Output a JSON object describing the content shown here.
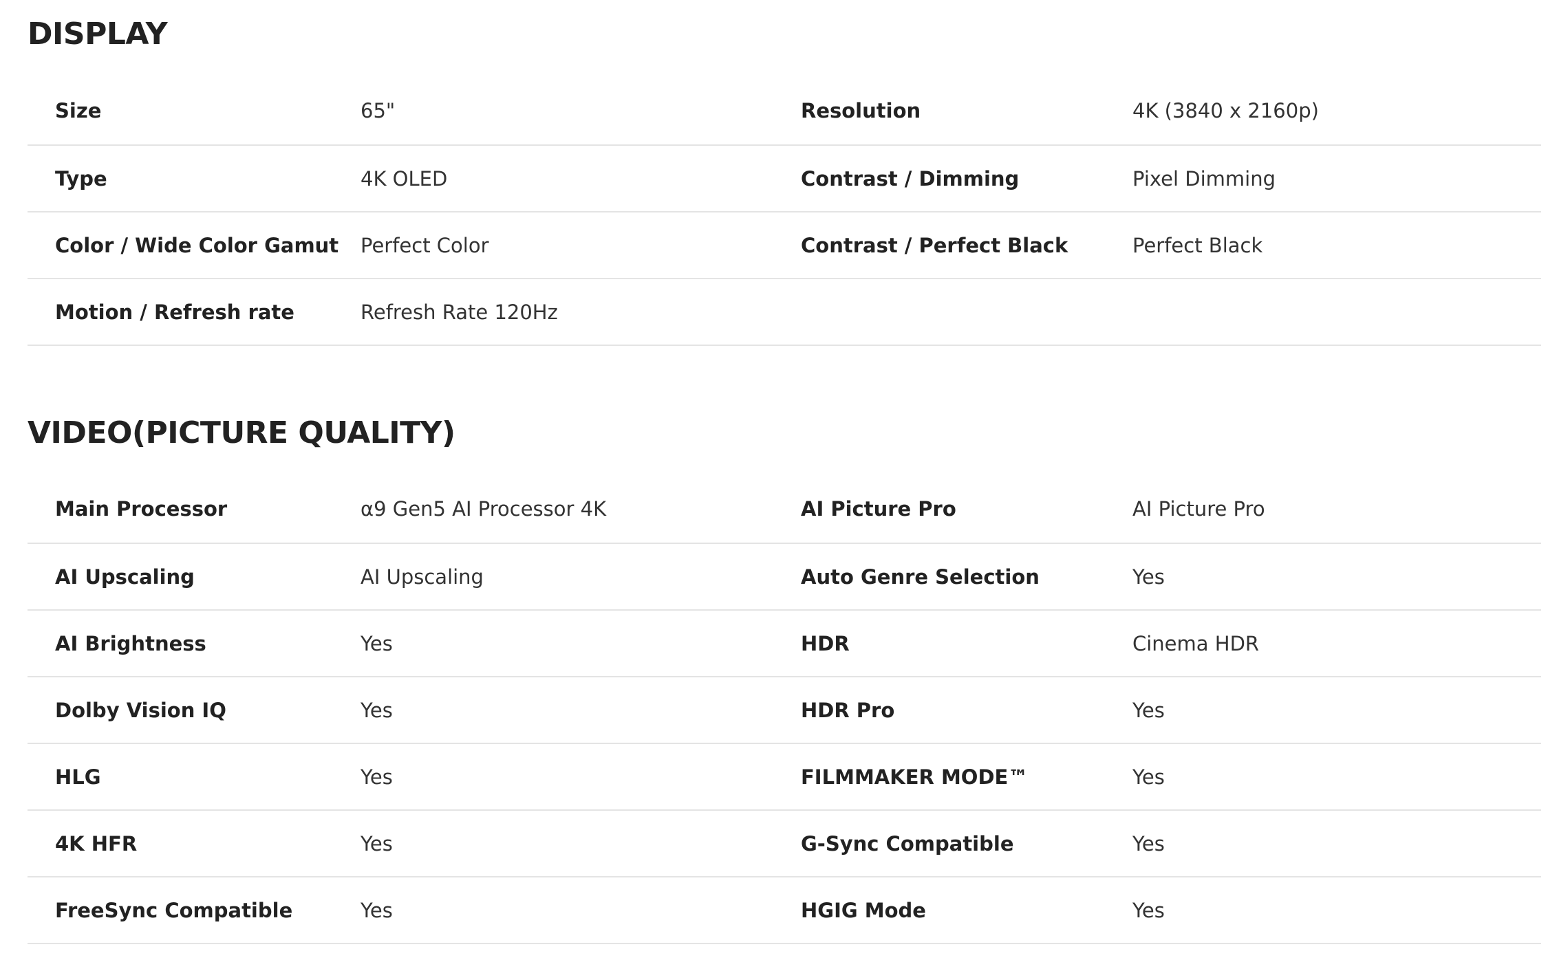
{
  "sections": [
    {
      "title": "DISPLAY",
      "rows": [
        {
          "label1": "Size",
          "value1": "65\"",
          "label2": "Resolution",
          "value2": "4K (3840 x 2160p)"
        },
        {
          "label1": "Type",
          "value1": "4K OLED",
          "label2": "Contrast / Dimming",
          "value2": "Pixel Dimming"
        },
        {
          "label1": "Color / Wide Color Gamut",
          "value1": "Perfect Color",
          "label2": "Contrast / Perfect Black",
          "value2": "Perfect Black"
        },
        {
          "label1": "Motion / Refresh rate",
          "value1": "Refresh Rate 120Hz",
          "label2": "",
          "value2": ""
        }
      ]
    },
    {
      "title": "VIDEO(PICTURE QUALITY)",
      "rows": [
        {
          "label1": "Main Processor",
          "value1": "α9 Gen5 AI Processor 4K",
          "label2": "AI Picture Pro",
          "value2": "AI Picture Pro"
        },
        {
          "label1": "AI Upscaling",
          "value1": "AI Upscaling",
          "label2": "Auto Genre Selection",
          "value2": "Yes"
        },
        {
          "label1": "AI Brightness",
          "value1": "Yes",
          "label2": "HDR",
          "value2": "Cinema HDR"
        },
        {
          "label1": "Dolby Vision IQ",
          "value1": "Yes",
          "label2": "HDR Pro",
          "value2": "Yes"
        },
        {
          "label1": "HLG",
          "value1": "Yes",
          "label2": "FILMMAKER MODE™",
          "value2": "Yes"
        },
        {
          "label1": "4K HFR",
          "value1": "Yes",
          "label2": "G-Sync Compatible",
          "value2": "Yes"
        },
        {
          "label1": "FreeSync Compatible",
          "value1": "Yes",
          "label2": "HGIG Mode",
          "value2": "Yes"
        }
      ]
    }
  ]
}
